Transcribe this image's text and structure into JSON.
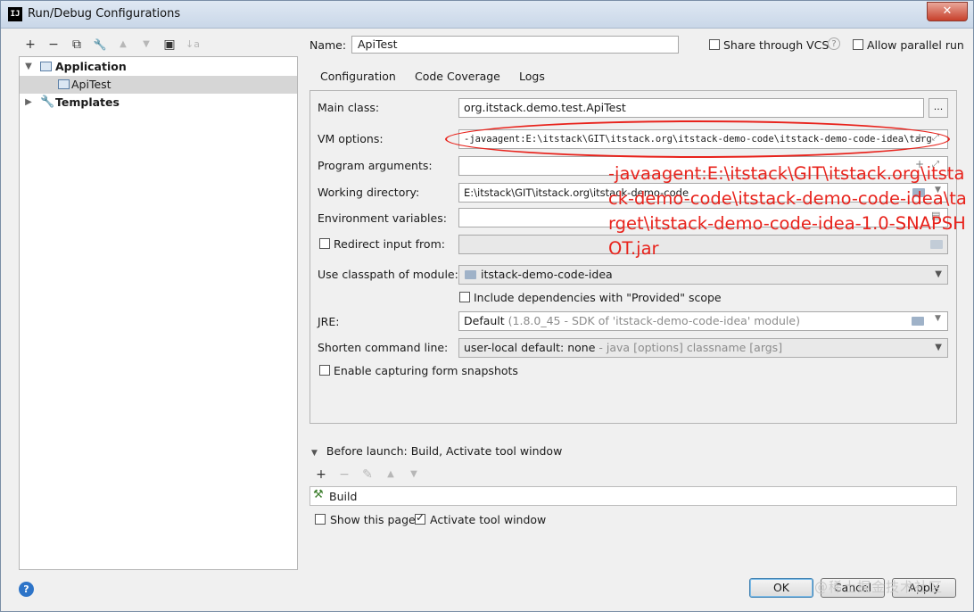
{
  "window": {
    "title": "Run/Debug Configurations",
    "app_icon": "IJ",
    "close": "✕"
  },
  "left_toolbar": {
    "add": "+",
    "remove": "−",
    "copy": "⧉",
    "edit": "🔧",
    "up": "▲",
    "down": "▼",
    "folder": "▣",
    "sort": "↓a"
  },
  "tree": {
    "application": "Application",
    "api_test": "ApiTest",
    "templates": "Templates"
  },
  "header": {
    "name_label": "Name:",
    "name_value": "ApiTest",
    "share_label": "Share through VCS",
    "share_checked": false,
    "parallel_label": "Allow parallel run",
    "parallel_checked": false,
    "help": "?"
  },
  "tabs": [
    {
      "label": "Configuration",
      "active": true
    },
    {
      "label": "Code Coverage",
      "active": false
    },
    {
      "label": "Logs",
      "active": false
    }
  ],
  "form": {
    "main_class_label": "Main class:",
    "main_class_value": "org.itstack.demo.test.ApiTest",
    "main_class_btn": "...",
    "vm_options_label": "VM options:",
    "vm_options_value": "-javaagent:E:\\itstack\\GIT\\itstack.org\\itstack-demo-code\\itstack-demo-code-idea\\targ",
    "program_args_label": "Program arguments:",
    "program_args_value": "",
    "working_dir_label": "Working directory:",
    "working_dir_value": "E:\\itstack\\GIT\\itstack.org\\itstack-demo-code",
    "env_vars_label": "Environment variables:",
    "env_vars_value": "",
    "redirect_label": "Redirect input from:",
    "redirect_checked": false,
    "classpath_label": "Use classpath of module:",
    "classpath_value": "itstack-demo-code-idea",
    "include_deps_label": "Include dependencies with \"Provided\" scope",
    "include_deps_checked": false,
    "jre_label": "JRE:",
    "jre_value": "Default",
    "jre_detail": "(1.8.0_45 - SDK of 'itstack-demo-code-idea' module)",
    "shorten_label": "Shorten command line:",
    "shorten_value": "user-local default: none",
    "shorten_detail": "- java [options] classname [args]",
    "snapshots_label": "Enable capturing form snapshots",
    "snapshots_checked": false
  },
  "annotation": {
    "text": "-javaagent:E:\\itstack\\GIT\\itstack.org\\itstack-demo-code\\itstack-demo-code-idea\\target\\itstack-demo-code-idea-1.0-SNAPSHOT.jar",
    "color": "#e8231c"
  },
  "before_launch": {
    "title": "Before launch: Build, Activate tool window",
    "toolbar": {
      "add": "+",
      "remove": "−",
      "edit": "✎",
      "up": "▲",
      "down": "▼"
    },
    "items": [
      "Build"
    ],
    "show_page_label": "Show this page",
    "show_page_checked": false,
    "activate_label": "Activate tool window",
    "activate_checked": true
  },
  "footer": {
    "help": "?",
    "ok": "OK",
    "cancel": "Cancel",
    "apply": "Apply",
    "watermark": "@稀土掘金技术社区"
  },
  "colors": {
    "accent": "#4083c9",
    "annotation_red": "#e8231c",
    "help_blue": "#2d74c8"
  }
}
